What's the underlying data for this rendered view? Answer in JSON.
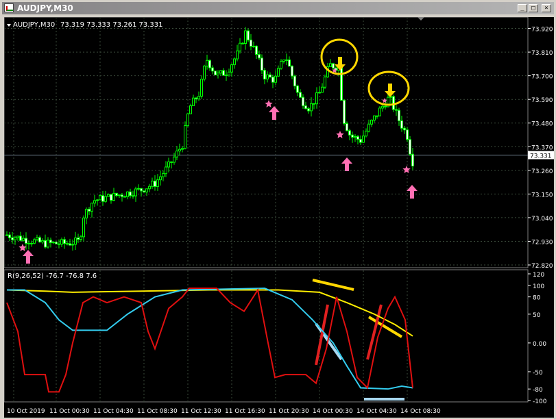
{
  "window": {
    "title": "AUDJPY,M30",
    "buttons": {
      "minimize": "_",
      "maximize": "□",
      "close": "×"
    }
  },
  "main_chart": {
    "header": "AUDJPY,M30",
    "ohlc": "73.319 73.333 73.261 73.331",
    "price_labels": [
      "73.920",
      "73.810",
      "73.700",
      "73.590",
      "73.480",
      "73.370",
      "73.260",
      "73.150",
      "73.040",
      "72.930",
      "72.820"
    ],
    "current_price": "73.331"
  },
  "indicator": {
    "header": "R(9,26,52) -76.7 -76.8 7.6",
    "labels": [
      "120",
      "100",
      "80",
      "50",
      "0.00",
      "-50",
      "-80",
      "-100"
    ]
  },
  "time_labels": [
    "10 Oct 2019",
    "11 Oct 00:30",
    "11 Oct 04:30",
    "11 Oct 08:30",
    "11 Oct 12:30",
    "11 Oct 16:30",
    "11 Oct 20:30",
    "14 Oct 00:30",
    "14 Oct 04:30",
    "14 Oct 08:30"
  ],
  "colors": {
    "background": "#000000",
    "grid": "#3a4a3a",
    "bull_candle": "#ffffff",
    "bear_candle": "#00ff00",
    "pink_marker": "#ff6fb3",
    "yellow_marker": "#ffd700",
    "fast_line": "#e01010",
    "mid_line": "#33ccee",
    "slow_line": "#ffee00"
  },
  "chart_data": {
    "type": "candlestick",
    "symbol": "AUDJPY",
    "timeframe": "M30",
    "ylim": [
      72.82,
      73.96
    ],
    "candles": [],
    "oscillator": {
      "ylim": [
        -100,
        120
      ],
      "series": [
        {
          "name": "fast",
          "values": []
        },
        {
          "name": "mid",
          "values": []
        },
        {
          "name": "slow",
          "values": []
        }
      ]
    }
  }
}
